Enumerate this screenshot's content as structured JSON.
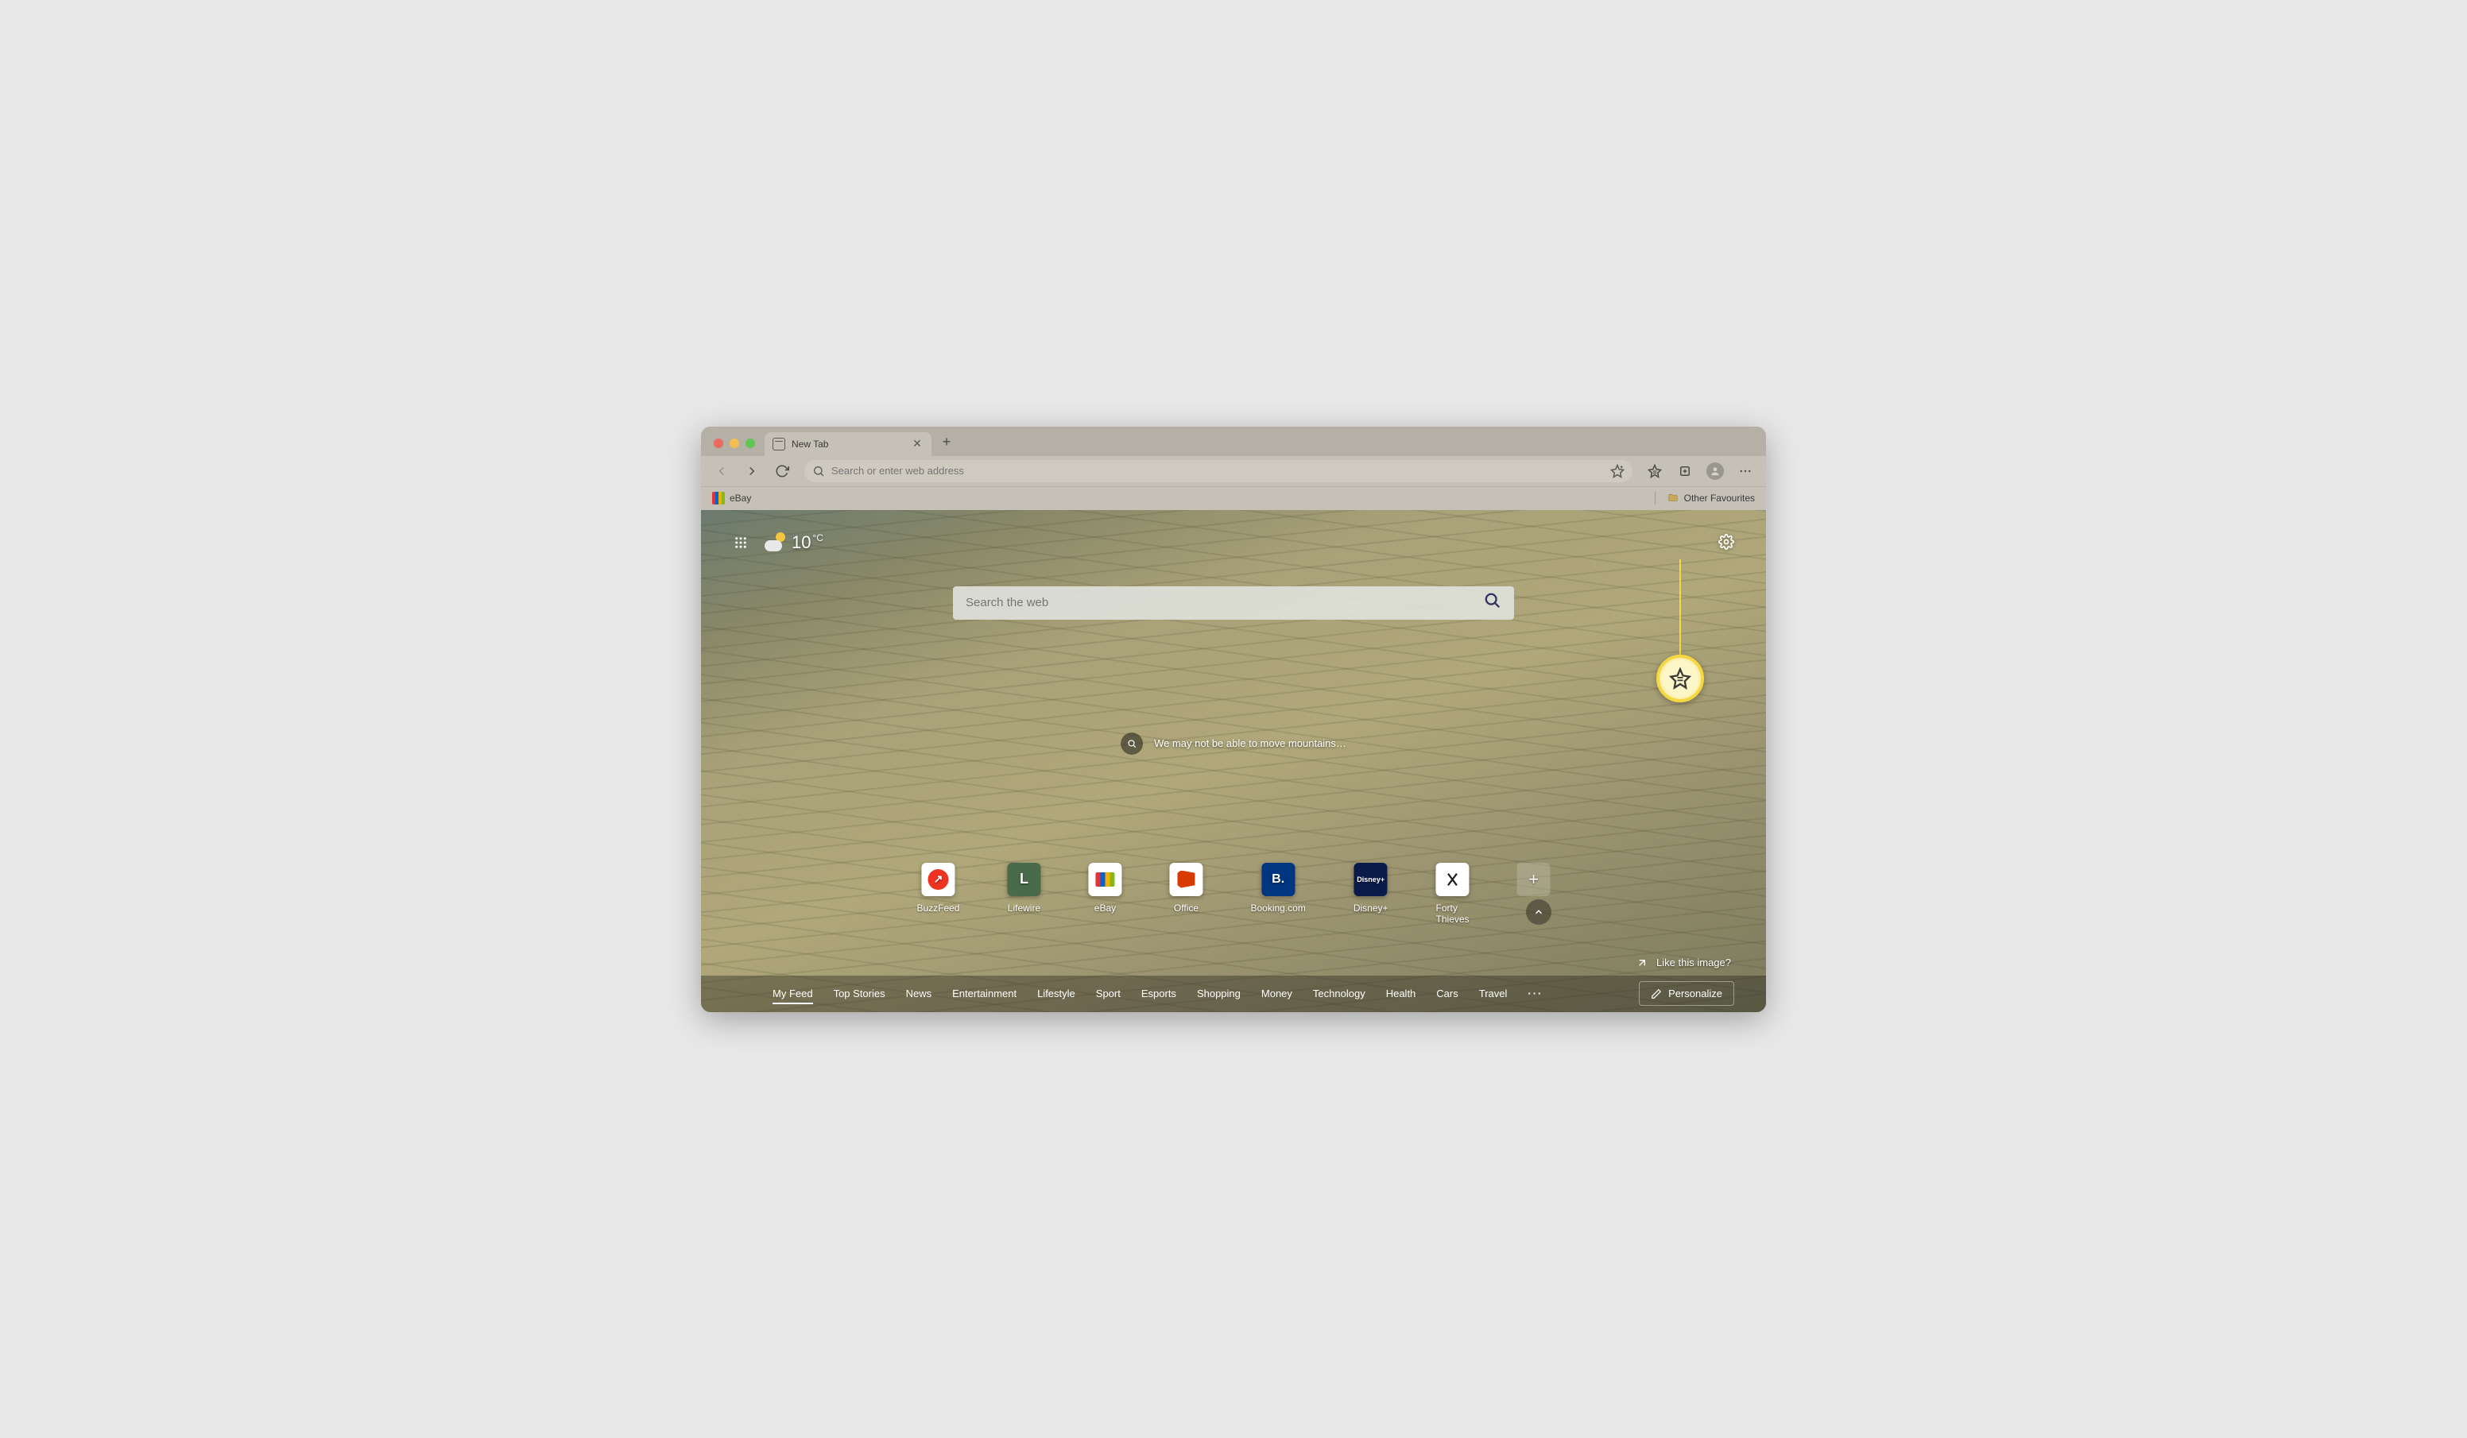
{
  "tab": {
    "title": "New Tab"
  },
  "address": {
    "placeholder": "Search or enter web address"
  },
  "fav_bar": {
    "ebay": "eBay",
    "other": "Other Favourites"
  },
  "weather": {
    "temp": "10",
    "unit": "°C"
  },
  "search": {
    "placeholder": "Search the web"
  },
  "caption": "We may not be able to move mountains…",
  "tiles": [
    {
      "label": "BuzzFeed"
    },
    {
      "label": "Lifewire"
    },
    {
      "label": "eBay"
    },
    {
      "label": "Office"
    },
    {
      "label": "Booking.com"
    },
    {
      "label": "Disney+"
    },
    {
      "label": "Forty Thieves"
    }
  ],
  "like_image": "Like this image?",
  "feed": {
    "items": [
      "My Feed",
      "Top Stories",
      "News",
      "Entertainment",
      "Lifestyle",
      "Sport",
      "Esports",
      "Shopping",
      "Money",
      "Technology",
      "Health",
      "Cars",
      "Travel"
    ],
    "personalize": "Personalize"
  }
}
